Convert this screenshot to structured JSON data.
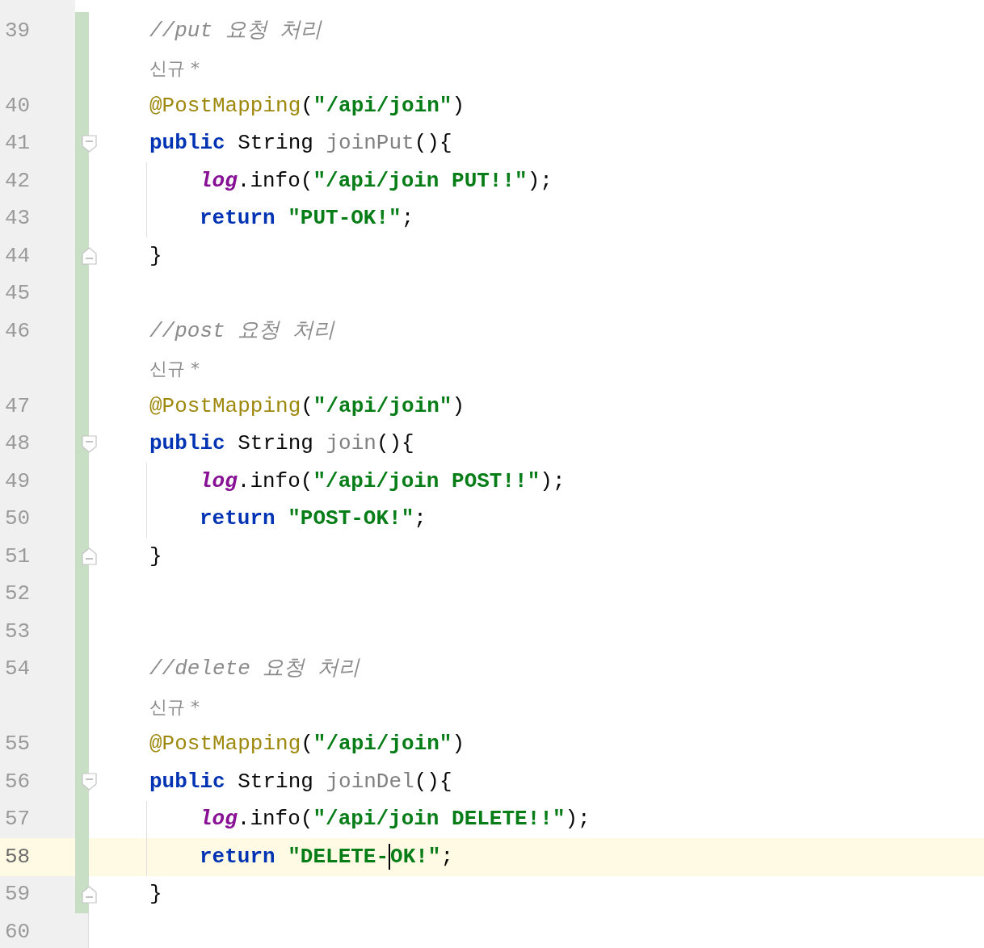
{
  "editor": {
    "lines": [
      {
        "number": "39",
        "kind": "code",
        "changed": true,
        "tokens": [
          {
            "kind": "comment",
            "text": "//put 요청 처리"
          }
        ]
      },
      {
        "kind": "hint",
        "changed": true,
        "text": "신규 *"
      },
      {
        "number": "40",
        "kind": "code",
        "changed": true,
        "tokens": [
          {
            "kind": "annotation",
            "text": "@PostMapping"
          },
          {
            "kind": "plain",
            "text": "("
          },
          {
            "kind": "string",
            "text": "\"/api/join\""
          },
          {
            "kind": "plain",
            "text": ")"
          }
        ]
      },
      {
        "number": "41",
        "kind": "code",
        "changed": true,
        "fold_start": true,
        "tokens": [
          {
            "kind": "keyword",
            "text": "public"
          },
          {
            "kind": "plain",
            "text": " String "
          },
          {
            "kind": "unused",
            "text": "joinPut"
          },
          {
            "kind": "plain",
            "text": "(){"
          }
        ]
      },
      {
        "number": "42",
        "kind": "code",
        "changed": true,
        "guide": true,
        "tokens": [
          {
            "kind": "field",
            "text": "log"
          },
          {
            "kind": "plain",
            "text": ".info("
          },
          {
            "kind": "string",
            "text": "\"/api/join PUT!!\""
          },
          {
            "kind": "plain",
            "text": ");"
          }
        ]
      },
      {
        "number": "43",
        "kind": "code",
        "changed": true,
        "guide": true,
        "tokens": [
          {
            "kind": "keyword",
            "text": "return",
            "space_after": true
          },
          {
            "kind": "string",
            "text": "\"PUT-OK!\""
          },
          {
            "kind": "plain",
            "text": ";"
          }
        ]
      },
      {
        "number": "44",
        "kind": "code",
        "changed": true,
        "fold_end": true,
        "tokens": [
          {
            "kind": "plain",
            "text": "}"
          }
        ]
      },
      {
        "number": "45",
        "kind": "code",
        "changed": true
      },
      {
        "number": "46",
        "kind": "code",
        "changed": true,
        "tokens": [
          {
            "kind": "comment",
            "text": "//post 요청 처리"
          }
        ]
      },
      {
        "kind": "hint",
        "changed": true,
        "text": "신규 *"
      },
      {
        "number": "47",
        "kind": "code",
        "changed": true,
        "tokens": [
          {
            "kind": "annotation",
            "text": "@PostMapping"
          },
          {
            "kind": "plain",
            "text": "("
          },
          {
            "kind": "string",
            "text": "\"/api/join\""
          },
          {
            "kind": "plain",
            "text": ")"
          }
        ]
      },
      {
        "number": "48",
        "kind": "code",
        "changed": true,
        "fold_start": true,
        "tokens": [
          {
            "kind": "keyword",
            "text": "public"
          },
          {
            "kind": "plain",
            "text": " String "
          },
          {
            "kind": "unused",
            "text": "join"
          },
          {
            "kind": "plain",
            "text": "(){"
          }
        ]
      },
      {
        "number": "49",
        "kind": "code",
        "changed": true,
        "guide": true,
        "tokens": [
          {
            "kind": "field",
            "text": "log"
          },
          {
            "kind": "plain",
            "text": ".info("
          },
          {
            "kind": "string",
            "text": "\"/api/join POST!!\""
          },
          {
            "kind": "plain",
            "text": ");"
          }
        ]
      },
      {
        "number": "50",
        "kind": "code",
        "changed": true,
        "guide": true,
        "tokens": [
          {
            "kind": "keyword",
            "text": "return",
            "space_after": true
          },
          {
            "kind": "string",
            "text": "\"POST-OK!\""
          },
          {
            "kind": "plain",
            "text": ";"
          }
        ]
      },
      {
        "number": "51",
        "kind": "code",
        "changed": true,
        "fold_end": true,
        "tokens": [
          {
            "kind": "plain",
            "text": "}"
          }
        ]
      },
      {
        "number": "52",
        "kind": "code",
        "changed": true
      },
      {
        "number": "53",
        "kind": "code",
        "changed": true
      },
      {
        "number": "54",
        "kind": "code",
        "changed": true,
        "tokens": [
          {
            "kind": "comment",
            "text": "//delete 요청 처리"
          }
        ]
      },
      {
        "kind": "hint",
        "changed": true,
        "text": "신규 *"
      },
      {
        "number": "55",
        "kind": "code",
        "changed": true,
        "tokens": [
          {
            "kind": "annotation",
            "text": "@PostMapping"
          },
          {
            "kind": "plain",
            "text": "("
          },
          {
            "kind": "string",
            "text": "\"/api/join\""
          },
          {
            "kind": "plain",
            "text": ")"
          }
        ]
      },
      {
        "number": "56",
        "kind": "code",
        "changed": true,
        "fold_start": true,
        "tokens": [
          {
            "kind": "keyword",
            "text": "public"
          },
          {
            "kind": "plain",
            "text": " String "
          },
          {
            "kind": "unused",
            "text": "joinDel"
          },
          {
            "kind": "plain",
            "text": "(){"
          }
        ]
      },
      {
        "number": "57",
        "kind": "code",
        "changed": true,
        "guide": true,
        "tokens": [
          {
            "kind": "field",
            "text": "log"
          },
          {
            "kind": "plain",
            "text": ".info("
          },
          {
            "kind": "string",
            "text": "\"/api/join DELETE!!\""
          },
          {
            "kind": "plain",
            "text": ");"
          }
        ]
      },
      {
        "number": "58",
        "kind": "code",
        "changed": true,
        "guide": true,
        "current": true,
        "tokens": [
          {
            "kind": "keyword",
            "text": "return",
            "space_after": true
          },
          {
            "kind": "string",
            "text": "\"DELETE-"
          },
          {
            "kind": "caret"
          },
          {
            "kind": "string",
            "text": "OK!\""
          },
          {
            "kind": "plain",
            "text": ";"
          }
        ]
      },
      {
        "number": "59",
        "kind": "code",
        "changed": true,
        "fold_end": true,
        "tokens": [
          {
            "kind": "plain",
            "text": "}"
          }
        ]
      },
      {
        "number": "60",
        "kind": "code",
        "changed": false
      }
    ]
  }
}
